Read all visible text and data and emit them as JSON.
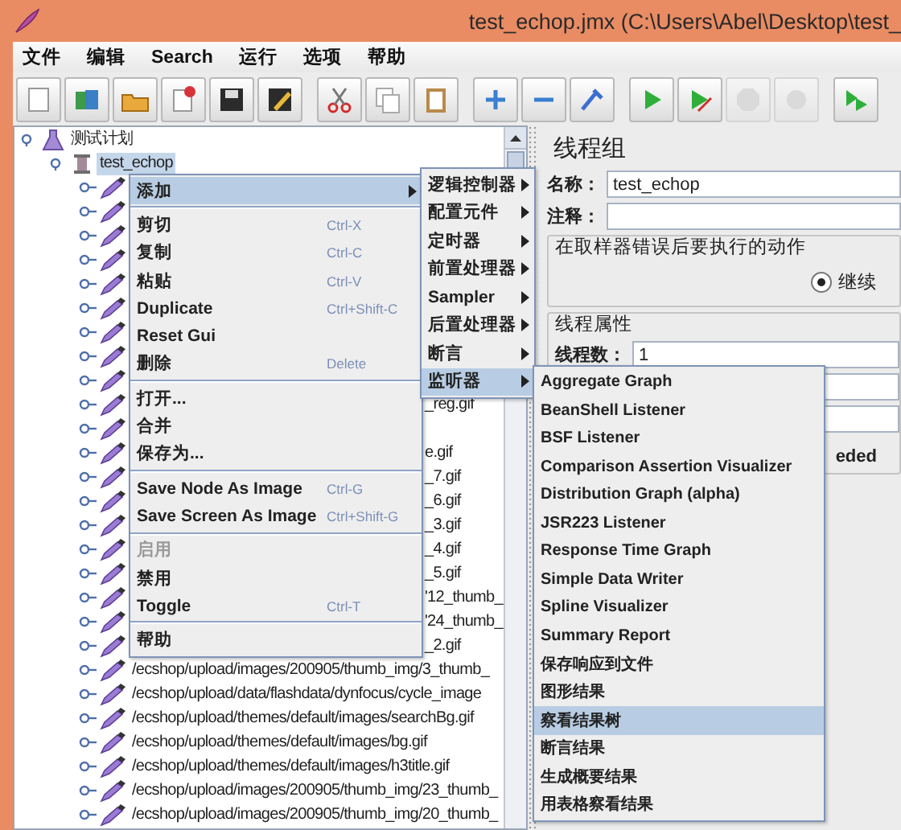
{
  "window": {
    "title": "test_echop.jmx (C:\\Users\\Abel\\Desktop\\test_"
  },
  "menu_bar": [
    "文件",
    "编辑",
    "Search",
    "运行",
    "选项",
    "帮助"
  ],
  "toolbar": [
    {
      "disabled": false
    },
    {
      "disabled": false
    },
    {
      "disabled": false
    },
    {
      "disabled": false
    },
    {
      "disabled": false
    },
    {
      "disabled": false
    },
    {
      "disabled": false
    },
    {
      "disabled": false
    },
    {
      "disabled": false
    },
    {
      "disabled": false
    },
    {
      "disabled": false
    },
    {
      "disabled": false
    },
    {
      "disabled": false
    },
    {
      "disabled": false
    },
    {
      "disabled": true
    },
    {
      "disabled": true
    },
    {
      "disabled": false
    }
  ],
  "tree": {
    "label": "测试计划",
    "selected": false,
    "expanded": true,
    "children": [
      {
        "label": "test_echop",
        "selected": true,
        "expanded": true,
        "children": [
          {
            "kind": "covered",
            "selected": false,
            "expanded": false
          },
          {
            "kind": "covered",
            "selected": false,
            "expanded": false
          },
          {
            "kind": "covered",
            "selected": false,
            "expanded": false
          },
          {
            "kind": "covered",
            "selected": false,
            "expanded": false
          },
          {
            "kind": "covered",
            "selected": false,
            "expanded": false
          },
          {
            "kind": "covered",
            "selected": false,
            "expanded": false
          },
          {
            "kind": "covered",
            "selected": false,
            "expanded": false
          },
          {
            "kind": "covered",
            "selected": false,
            "expanded": false
          },
          {
            "kind": "covered",
            "selected": false,
            "expanded": false
          },
          {
            "kind": "partial",
            "label": "_reg.gif",
            "selected": false,
            "expanded": false
          },
          {
            "kind": "covered",
            "selected": false,
            "expanded": false
          },
          {
            "kind": "partial",
            "label": "e.gif",
            "selected": false,
            "expanded": false
          },
          {
            "kind": "partial",
            "label": "_7.gif",
            "selected": false,
            "expanded": false
          },
          {
            "kind": "partial",
            "label": "_6.gif",
            "selected": false,
            "expanded": false
          },
          {
            "kind": "partial",
            "label": "_3.gif",
            "selected": false,
            "expanded": false
          },
          {
            "kind": "partial",
            "label": "_4.gif",
            "selected": false,
            "expanded": false
          },
          {
            "kind": "partial",
            "label": "_5.gif",
            "selected": false,
            "expanded": false
          },
          {
            "kind": "partial",
            "label": "'12_thumb_",
            "selected": false,
            "expanded": false
          },
          {
            "kind": "partial",
            "label": "'24_thumb_",
            "selected": false,
            "expanded": false
          },
          {
            "kind": "partial",
            "label": "_2.gif",
            "selected": false,
            "expanded": false
          },
          {
            "kind": "full",
            "label": "/ecshop/upload/images/200905/thumb_img/3_thumb_",
            "selected": false,
            "expanded": false
          },
          {
            "kind": "full",
            "label": "/ecshop/upload/data/flashdata/dynfocus/cycle_image",
            "selected": false,
            "expanded": false
          },
          {
            "kind": "full",
            "label": "/ecshop/upload/themes/default/images/searchBg.gif",
            "selected": false,
            "expanded": false
          },
          {
            "kind": "full",
            "label": "/ecshop/upload/themes/default/images/bg.gif",
            "selected": false,
            "expanded": false
          },
          {
            "kind": "full",
            "label": "/ecshop/upload/themes/default/images/h3title.gif",
            "selected": false,
            "expanded": false
          },
          {
            "kind": "full",
            "label": "/ecshop/upload/images/200905/thumb_img/23_thumb_",
            "selected": false,
            "expanded": false
          },
          {
            "kind": "full",
            "label": "/ecshop/upload/images/200905/thumb_img/20_thumb_",
            "selected": false,
            "expanded": false
          }
        ]
      }
    ]
  },
  "thread_group": {
    "title": "线程组",
    "name_label": "名称：",
    "name_value": "test_echop",
    "comment_label": "注释：",
    "error_action": {
      "title": "在取样器错误后要执行的动作",
      "options": [
        {
          "label": "继续",
          "selected": true
        }
      ]
    },
    "thread_properties": {
      "title": "线程属性",
      "threads_label": "线程数：",
      "threads_value": "1"
    },
    "cut_text": "eded"
  },
  "context_menu": {
    "sections": [
      [
        {
          "label": "添加",
          "submenu": true,
          "selected": true,
          "disabled": false
        }
      ],
      [
        {
          "label": "剪切",
          "shortcut": "Ctrl-X",
          "submenu": false,
          "selected": false,
          "disabled": false
        },
        {
          "label": "复制",
          "shortcut": "Ctrl-C",
          "submenu": false,
          "selected": false,
          "disabled": false
        },
        {
          "label": "粘贴",
          "shortcut": "Ctrl-V",
          "submenu": false,
          "selected": false,
          "disabled": false
        },
        {
          "label": "Duplicate",
          "shortcut": "Ctrl+Shift-C",
          "submenu": false,
          "selected": false,
          "disabled": false
        },
        {
          "label": "Reset Gui",
          "submenu": false,
          "selected": false,
          "disabled": false
        },
        {
          "label": "删除",
          "shortcut": "Delete",
          "submenu": false,
          "selected": false,
          "disabled": false
        }
      ],
      [
        {
          "label": "打开...",
          "submenu": false,
          "selected": false,
          "disabled": false
        },
        {
          "label": "合并",
          "submenu": false,
          "selected": false,
          "disabled": false
        },
        {
          "label": "保存为...",
          "submenu": false,
          "selected": false,
          "disabled": false
        }
      ],
      [
        {
          "label": "Save Node As Image",
          "shortcut": "Ctrl-G",
          "submenu": false,
          "selected": false,
          "disabled": false
        },
        {
          "label": "Save Screen As Image",
          "shortcut": "Ctrl+Shift-G",
          "submenu": false,
          "selected": false,
          "disabled": false
        }
      ],
      [
        {
          "label": "启用",
          "submenu": false,
          "selected": false,
          "disabled": true
        },
        {
          "label": "禁用",
          "submenu": false,
          "selected": false,
          "disabled": false
        },
        {
          "label": "Toggle",
          "shortcut": "Ctrl-T",
          "submenu": false,
          "selected": false,
          "disabled": false
        }
      ],
      [
        {
          "label": "帮助",
          "submenu": false,
          "selected": false,
          "disabled": false
        }
      ]
    ]
  },
  "add_submenu": [
    {
      "label": "逻辑控制器",
      "submenu": true,
      "selected": false
    },
    {
      "label": "配置元件",
      "submenu": true,
      "selected": false
    },
    {
      "label": "定时器",
      "submenu": true,
      "selected": false
    },
    {
      "label": "前置处理器",
      "submenu": true,
      "selected": false
    },
    {
      "label": "Sampler",
      "submenu": true,
      "selected": false
    },
    {
      "label": "后置处理器",
      "submenu": true,
      "selected": false
    },
    {
      "label": "断言",
      "submenu": true,
      "selected": false
    },
    {
      "label": "监听器",
      "submenu": true,
      "selected": true
    }
  ],
  "listener_submenu": [
    {
      "label": "Aggregate Graph",
      "selected": false
    },
    {
      "label": "BeanShell Listener",
      "selected": false
    },
    {
      "label": "BSF Listener",
      "selected": false
    },
    {
      "label": "Comparison Assertion Visualizer",
      "selected": false
    },
    {
      "label": "Distribution Graph (alpha)",
      "selected": false
    },
    {
      "label": "JSR223 Listener",
      "selected": false
    },
    {
      "label": "Response Time Graph",
      "selected": false
    },
    {
      "label": "Simple Data Writer",
      "selected": false
    },
    {
      "label": "Spline Visualizer",
      "selected": false
    },
    {
      "label": "Summary Report",
      "selected": false
    },
    {
      "label": "保存响应到文件",
      "selected": false
    },
    {
      "label": "图形结果",
      "selected": false
    },
    {
      "label": "察看结果树",
      "selected": true
    },
    {
      "label": "断言结果",
      "selected": false
    },
    {
      "label": "生成概要结果",
      "selected": false
    },
    {
      "label": "用表格察看结果",
      "selected": false
    }
  ]
}
